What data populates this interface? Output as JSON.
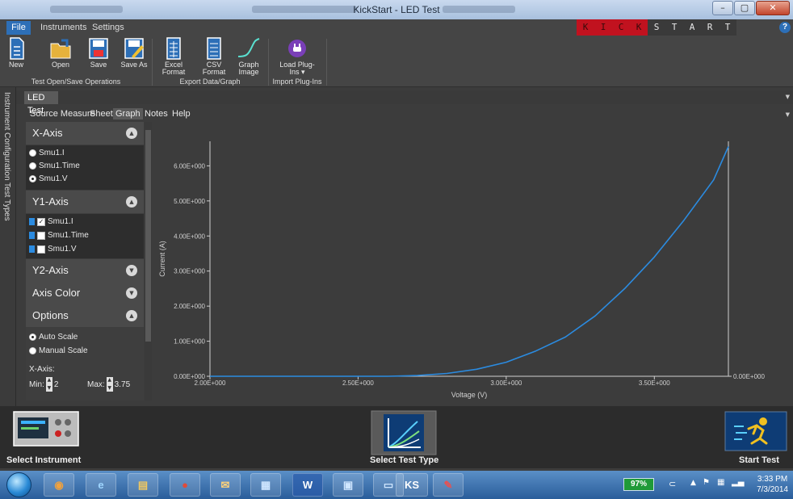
{
  "window": {
    "title": "KickStart - LED Test",
    "brand_letters": [
      "K",
      "I",
      "C",
      "K",
      "S",
      "T",
      "A",
      "R",
      "T"
    ],
    "controls": [
      "minimize",
      "maximize",
      "close"
    ]
  },
  "menu": {
    "file": "File",
    "instruments": "Instruments",
    "settings": "Settings",
    "help_glyph": "?"
  },
  "ribbon": {
    "buttons": [
      {
        "label": "New",
        "icon": "new-file-icon"
      },
      {
        "label": "Open",
        "icon": "open-folder-icon"
      },
      {
        "label": "Save",
        "icon": "save-disk-icon"
      },
      {
        "label": "Save As",
        "icon": "save-as-icon"
      },
      {
        "label": "Excel Format",
        "icon": "excel-doc-icon"
      },
      {
        "label": "CSV Format",
        "icon": "csv-doc-icon"
      },
      {
        "label": "Graph Image",
        "icon": "graph-image-icon"
      },
      {
        "label": "Load Plug-Ins ▾",
        "icon": "plugin-icon"
      }
    ],
    "groups": [
      "Test Open/Save Operations",
      "Export Data/Graph",
      "Import Plug-Ins"
    ]
  },
  "side_tabs": [
    "Instrument Configuration",
    "Test Types"
  ],
  "doc_tab": "LED Test",
  "sub_tabs": [
    "Source Measure",
    "Sheet",
    "Graph",
    "Notes",
    "Help"
  ],
  "active_sub_tab": "Graph",
  "panel": {
    "x_axis": {
      "header": "X-Axis",
      "options": [
        "Smu1.I",
        "Smu1.Time",
        "Smu1.V"
      ],
      "selected": "Smu1.V"
    },
    "y1_axis": {
      "header": "Y1-Axis",
      "options": [
        "Smu1.I",
        "Smu1.Time",
        "Smu1.V"
      ],
      "checked": [
        "Smu1.I"
      ]
    },
    "y2_axis": {
      "header": "Y2-Axis"
    },
    "axis_color": {
      "header": "Axis Color"
    },
    "options": {
      "header": "Options",
      "auto_scale": "Auto Scale",
      "manual_scale": "Manual Scale",
      "selected": "Auto Scale"
    },
    "x_range": {
      "label": "X-Axis:",
      "min_label": "Min:",
      "min_value": "2",
      "max_label": "Max:",
      "max_value": "3.75"
    }
  },
  "colors": {
    "accent": "#2d6fb7",
    "series": "#2b8be0",
    "brand_red": "#c1121f",
    "background": "#3c3c3c"
  },
  "chart_data": {
    "type": "line",
    "xlabel": "Voltage (V)",
    "ylabel": "Current (A)",
    "xlim": [
      2.0,
      3.75
    ],
    "ylim": [
      0,
      6.7
    ],
    "x_ticks": [
      2.0,
      2.5,
      3.0,
      3.5
    ],
    "x_tick_labels": [
      "2.00E+000",
      "2.50E+000",
      "3.00E+000",
      "3.50E+000"
    ],
    "y_ticks": [
      0,
      1,
      2,
      3,
      4,
      5,
      6
    ],
    "y_tick_labels": [
      "0.00E+000",
      "1.00E+000",
      "2.00E+000",
      "3.00E+000",
      "4.00E+000",
      "5.00E+000",
      "6.00E+000"
    ],
    "y2_tick_labels": [
      "0.00E+000"
    ],
    "grid": false,
    "series": [
      {
        "x": [
          2.0,
          2.6,
          2.7,
          2.8,
          2.9,
          3.0,
          3.1,
          3.2,
          3.3,
          3.4,
          3.5,
          3.6,
          3.7,
          3.75
        ],
        "y": [
          0,
          0,
          0.02,
          0.08,
          0.2,
          0.4,
          0.72,
          1.12,
          1.72,
          2.5,
          3.4,
          4.45,
          5.6,
          6.55
        ]
      }
    ]
  },
  "bottom": {
    "select_instrument": "Select Instrument",
    "select_test_type": "Select Test Type",
    "start_test": "Start Test"
  },
  "taskbar": {
    "apps": [
      "outlook-icon",
      "ie-icon",
      "explorer-icon",
      "chrome-icon",
      "onenote-icon",
      "network-app-icon",
      "word-icon",
      "windows-app-icon",
      "remote-desktop-icon",
      "kickstart-icon",
      "editor-icon"
    ],
    "kickstart_label": "KS",
    "battery": "97%",
    "time": "3:33 PM",
    "date": "7/3/2014"
  }
}
